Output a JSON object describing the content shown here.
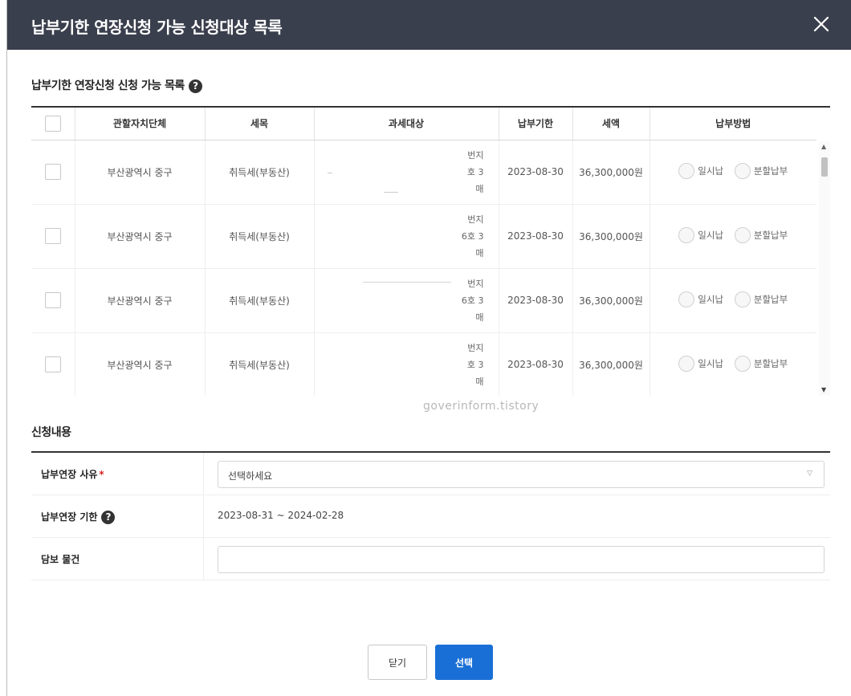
{
  "dialog": {
    "title": "납부기한 연장신청 가능 신청대상 목록"
  },
  "list_section": {
    "title": "납부기한 연장신청 신청 가능 목록"
  },
  "table": {
    "headers": [
      "관할자치단체",
      "세목",
      "과세대상",
      "납부기한",
      "세액",
      "납부방법"
    ],
    "rows": [
      {
        "authority": "부산광역시 중구",
        "tax_item": "취득세(부동산)",
        "target_lines": [
          "번지",
          "호 3",
          "매"
        ],
        "due_date": "2023-08-30",
        "amount": "36,300,000원"
      },
      {
        "authority": "부산광역시 중구",
        "tax_item": "취득세(부동산)",
        "target_lines": [
          "번지",
          "6호 3",
          "매"
        ],
        "due_date": "2023-08-30",
        "amount": "36,300,000원"
      },
      {
        "authority": "부산광역시 중구",
        "tax_item": "취득세(부동산)",
        "target_lines": [
          "번지",
          "6호 3",
          "매"
        ],
        "due_date": "2023-08-30",
        "amount": "36,300,000원"
      },
      {
        "authority": "부산광역시 중구",
        "tax_item": "취득세(부동산)",
        "target_lines": [
          "번지",
          "호 3",
          "매"
        ],
        "due_date": "2023-08-30",
        "amount": "36,300,000원"
      }
    ],
    "payment_options": [
      "일시납",
      "분할납부"
    ]
  },
  "watermark": "goverinform.tistory",
  "apply_section": {
    "title": "신청내용",
    "reason_label": "납부연장 사유",
    "reason_required_mark": "*",
    "reason_placeholder": "선택하세요",
    "period_label": "납부연장 기한",
    "period_value": "2023-08-31 ~ 2024-02-28",
    "collateral_label": "담보 물건",
    "collateral_value": ""
  },
  "buttons": {
    "close": "닫기",
    "select": "선택"
  },
  "colors": {
    "header_bg": "#3a3f4d",
    "primary": "#1a6fd6"
  },
  "icons": {
    "help": "?"
  }
}
